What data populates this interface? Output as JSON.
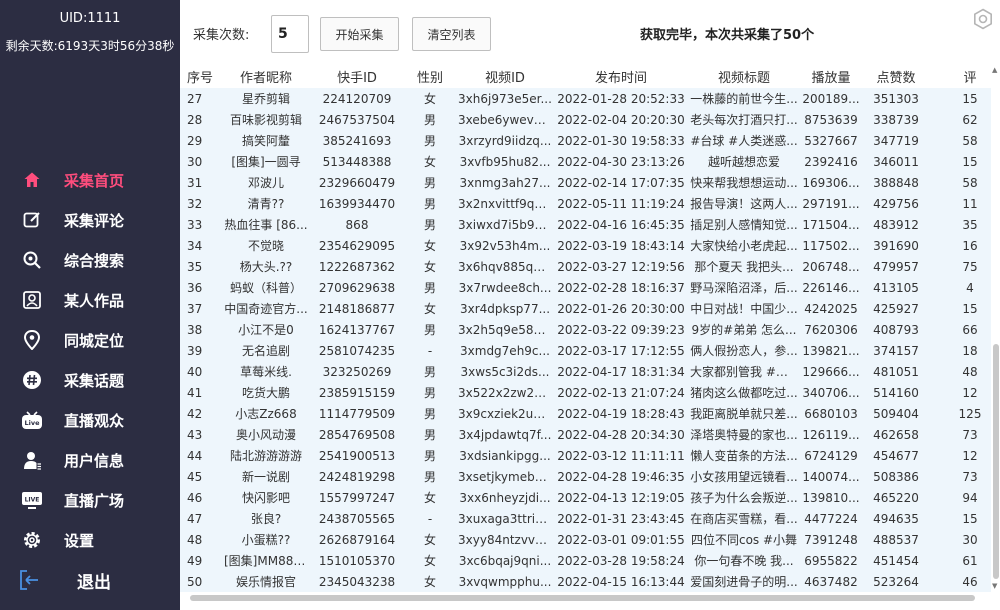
{
  "sidebar": {
    "uid": "UID:1111",
    "remaining": "剩余天数:6193天3时56分38秒",
    "items": [
      {
        "label": "采集首页",
        "icon": "home-icon",
        "active": true
      },
      {
        "label": "采集评论",
        "icon": "edit-icon"
      },
      {
        "label": "综合搜索",
        "icon": "search-icon"
      },
      {
        "label": "某人作品",
        "icon": "portrait-icon"
      },
      {
        "label": "同城定位",
        "icon": "location-icon"
      },
      {
        "label": "采集话题",
        "icon": "hashtag-icon"
      },
      {
        "label": "直播观众",
        "icon": "live-tv-icon"
      },
      {
        "label": "用户信息",
        "icon": "user-icon"
      },
      {
        "label": "直播广场",
        "icon": "live-screen-icon"
      },
      {
        "label": "设置",
        "icon": "gear-icon"
      }
    ],
    "logout": "退出"
  },
  "toolbar": {
    "count_label": "采集次数:",
    "count_value": "5",
    "start_label": "开始采集",
    "clear_label": "清空列表",
    "status": "获取完毕，本次共采集了50个"
  },
  "colors": {
    "sidebar_bg": "#2c2d42",
    "active": "#ff4d7d",
    "row_bg": "#eef6fc"
  },
  "table": {
    "columns": [
      "序号",
      "作者昵称",
      "快手ID",
      "性别",
      "视频ID",
      "发布时间",
      "视频标题",
      "播放量",
      "点赞数",
      "评"
    ],
    "rows": [
      [
        "27",
        "星乔剪辑",
        "224120709",
        "女",
        "3xh6j973e5er...",
        "2022-01-28 20:52:33",
        "一株藤的前世今生...",
        "200189...",
        "351303",
        "15"
      ],
      [
        "28",
        "百味影视剪辑",
        "2467537504",
        "男",
        "3xebe6yweve...",
        "2022-02-04 20:20:30",
        "老头每次打酒只打...",
        "8753639",
        "338739",
        "62"
      ],
      [
        "29",
        "搞笑阿釐",
        "385241693",
        "男",
        "3xrzyrd9iidzq...",
        "2022-01-30 19:58:33",
        "#台球 #人类迷惑...",
        "5327667",
        "347719",
        "58"
      ],
      [
        "30",
        "[图集]一圆寻",
        "513448388",
        "女",
        "3xvfb95hu82...",
        "2022-04-30 23:13:26",
        "越听越想恋爱",
        "2392416",
        "346011",
        "15"
      ],
      [
        "31",
        "邓波儿",
        "2329660479",
        "男",
        "3xnmg3ah27...",
        "2022-02-14 17:07:35",
        "快来帮我想想运动...",
        "169306...",
        "388848",
        "58"
      ],
      [
        "32",
        "清青??",
        "1639934470",
        "男",
        "3x2nxvittf9q3...",
        "2022-05-11 11:19:24",
        "报告导演！这两人...",
        "297191...",
        "429756",
        "11"
      ],
      [
        "33",
        "热血往事 [86...",
        "868",
        "男",
        "3xiwxd7i5b9n...",
        "2022-04-16 16:45:35",
        "插足别人感情知觉...",
        "171504...",
        "483912",
        "35"
      ],
      [
        "34",
        "不觉晓",
        "2354629095",
        "女",
        "3x92v53h4m...",
        "2022-03-19 18:43:14",
        "大家快给小老虎起...",
        "117502...",
        "391690",
        "16"
      ],
      [
        "35",
        "杨大头.??",
        "1222687362",
        "女",
        "3x6hqv885qq...",
        "2022-03-27 12:19:56",
        "那个夏天 我把头...",
        "206748...",
        "479957",
        "75"
      ],
      [
        "36",
        "蚂蚁（科普）",
        "2709629638",
        "男",
        "3x7rwdee8ch...",
        "2022-02-28 18:16:37",
        "野马深陷沼泽，后...",
        "226146...",
        "413105",
        "4"
      ],
      [
        "37",
        "中国奇迹官方...",
        "2148186877",
        "女",
        "3xr4dpksp77...",
        "2022-01-26 20:30:00",
        "中日对战！中国少...",
        "4242025",
        "425927",
        "15"
      ],
      [
        "38",
        "小江不是0",
        "1624137767",
        "男",
        "3x2h5q9e58u...",
        "2022-03-22 09:39:23",
        "9岁的#弟弟 怎么...",
        "7620306",
        "408793",
        "66"
      ],
      [
        "39",
        "无名追剧",
        "2581074235",
        "-",
        "3xmdg7eh9c...",
        "2022-03-17 17:12:55",
        "俩人假扮恋人，参...",
        "139821...",
        "374157",
        "18"
      ],
      [
        "40",
        "草莓米线.",
        "323250269",
        "男",
        "3xws5c3i2ds...",
        "2022-04-17 18:31:34",
        "大家都别管我 #妥...",
        "129666...",
        "481051",
        "48"
      ],
      [
        "41",
        "吃货大鹏",
        "2385915159",
        "男",
        "3x522x2zw2ej...",
        "2022-02-13 21:07:24",
        "猪肉这么做都吃过...",
        "340706...",
        "514160",
        "12"
      ],
      [
        "42",
        "小志Zz668",
        "1114779509",
        "男",
        "3x9cxziek2uvj...",
        "2022-04-19 18:28:43",
        "我距离脱单就只差...",
        "6680103",
        "509404",
        "125"
      ],
      [
        "43",
        "奥小风动漫",
        "2854769508",
        "男",
        "3x4jpdawtq7f...",
        "2022-04-28 20:34:30",
        "泽塔奥特曼的家也...",
        "126119...",
        "462658",
        "73"
      ],
      [
        "44",
        "陆北游游游游",
        "2541900513",
        "男",
        "3xdsiankipgg...",
        "2022-03-12 11:11:11",
        "懒人变苗条的方法...",
        "6724129",
        "454677",
        "12"
      ],
      [
        "45",
        "新一说剧",
        "2424819298",
        "男",
        "3xsetjkymeb6...",
        "2022-04-28 19:46:35",
        "小女孩用望远镜看...",
        "140074...",
        "508386",
        "73"
      ],
      [
        "46",
        "快闪影吧",
        "1557997247",
        "女",
        "3xx6nheyzjdi...",
        "2022-04-13 12:19:05",
        "孩子为什么会叛逆...",
        "139810...",
        "465220",
        "94"
      ],
      [
        "47",
        "张良?",
        "2438705565",
        "-",
        "3xuxaga3ttrivgi",
        "2022-01-31 23:43:45",
        "在商店买雪糕，看...",
        "4477224",
        "494635",
        "15"
      ],
      [
        "48",
        "小蛋糕??",
        "2626879164",
        "女",
        "3xyy84ntzvvb...",
        "2022-03-01 09:01:55",
        "四位不同cos #小舞",
        "7391248",
        "488537",
        "30"
      ],
      [
        "49",
        "[图集]MM88_...",
        "1510105370",
        "女",
        "3xc6bqaj9qni...",
        "2022-03-28 19:58:24",
        "你一句春不晚 我...",
        "6955822",
        "451454",
        "61"
      ],
      [
        "50",
        "娱乐情报官",
        "2345043238",
        "女",
        "3xvqwmpphu...",
        "2022-04-15 16:13:44",
        "爱国刻进骨子的明...",
        "4637482",
        "523264",
        "46"
      ]
    ]
  }
}
